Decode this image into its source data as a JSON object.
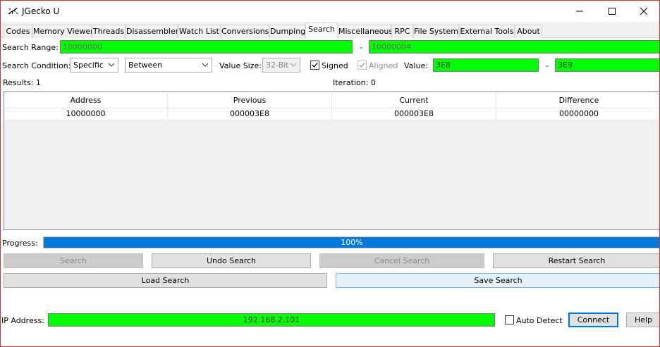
{
  "window": {
    "title": "JGecko U",
    "minimize_glyph": "—",
    "maximize_glyph": "☐",
    "close_glyph": "✕"
  },
  "tabs": [
    {
      "label": "Codes"
    },
    {
      "label": "Memory Viewer"
    },
    {
      "label": "Threads"
    },
    {
      "label": "Disassembler"
    },
    {
      "label": "Watch List"
    },
    {
      "label": "Conversions"
    },
    {
      "label": "Dumping"
    },
    {
      "label": "Search",
      "active": true
    },
    {
      "label": "Miscellaneous"
    },
    {
      "label": "RPC"
    },
    {
      "label": "File System"
    },
    {
      "label": "External Tools"
    },
    {
      "label": "About"
    }
  ],
  "search_range": {
    "label": "Search Range:",
    "start": "10000000",
    "separator": "-",
    "end": "10000004"
  },
  "search_condition": {
    "label": "Search Condition:",
    "mode": "Specific",
    "operator": "Between",
    "value_size_label": "Value Size:",
    "value_size": "32-Bit",
    "signed_label": "Signed",
    "signed_checked": true,
    "aligned_label": "Aligned",
    "aligned_checked": true,
    "value_label": "Value:",
    "value_from": "3E8",
    "separator": "-",
    "value_to": "3E9"
  },
  "status": {
    "results": "Results: 1",
    "iteration": "Iteration: 0"
  },
  "results_table": {
    "columns": [
      "Address",
      "Previous",
      "Current",
      "Difference"
    ],
    "rows": [
      [
        "10000000",
        "000003E8",
        "000003E8",
        "00000000"
      ]
    ]
  },
  "progress": {
    "label": "Progress:",
    "value": 1.0,
    "text": "100%"
  },
  "buttons": {
    "search": "Search",
    "undo_search": "Undo Search",
    "cancel_search": "Cancel Search",
    "restart_search": "Restart Search",
    "load_search": "Load Search",
    "save_search": "Save Search"
  },
  "connection": {
    "ip_label": "IP Address:",
    "ip_value": "192.168.2.101",
    "auto_detect_label": "Auto Detect",
    "auto_detect_checked": false,
    "connect": "Connect",
    "help": "Help"
  },
  "colors": {
    "valid_field": "#00ff00",
    "progress_fill": "#0678d7",
    "window_border": "#c83838"
  }
}
